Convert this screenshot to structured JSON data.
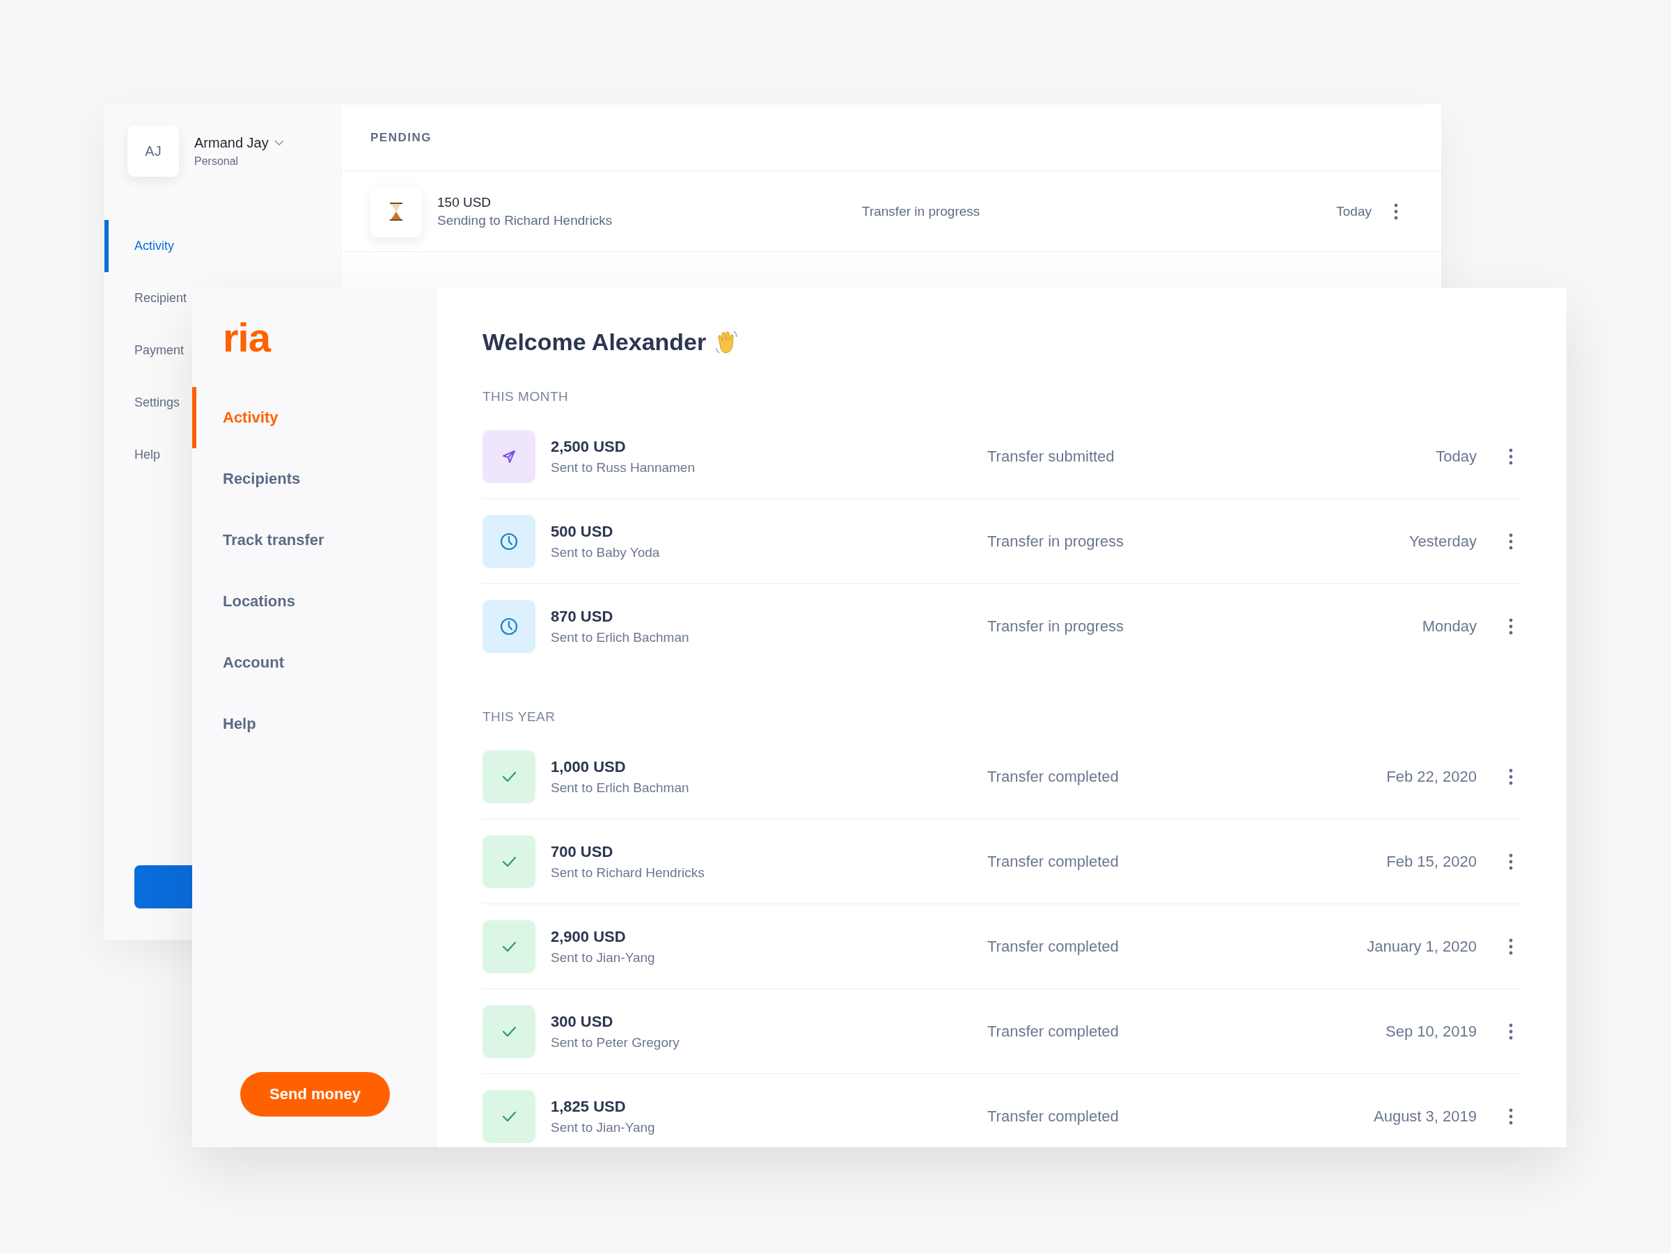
{
  "back_window": {
    "user": {
      "initials": "AJ",
      "name": "Armand Jay",
      "plan": "Personal"
    },
    "nav": [
      {
        "label": "Activity",
        "selected": true
      },
      {
        "label": "Recipient",
        "selected": false
      },
      {
        "label": "Payment",
        "selected": false
      },
      {
        "label": "Settings",
        "selected": false
      },
      {
        "label": "Help",
        "selected": false
      }
    ],
    "section": "PENDING",
    "pending": [
      {
        "amount": "150 USD",
        "description": "Sending to Richard Hendricks",
        "status": "Transfer in progress",
        "date": "Today"
      }
    ]
  },
  "front_window": {
    "logo": "ria",
    "nav": [
      {
        "label": "Activity",
        "selected": true
      },
      {
        "label": "Recipients",
        "selected": false
      },
      {
        "label": "Track transfer",
        "selected": false
      },
      {
        "label": "Locations",
        "selected": false
      },
      {
        "label": "Account",
        "selected": false
      },
      {
        "label": "Help",
        "selected": false
      }
    ],
    "send_button": "Send money",
    "greeting": "Welcome Alexander",
    "groups": [
      {
        "title": "THIS MONTH",
        "transfers": [
          {
            "kind": "submitted",
            "amount": "2,500 USD",
            "recipient": "Sent to Russ Hannamen",
            "status": "Transfer submitted",
            "date": "Today"
          },
          {
            "kind": "in_progress",
            "amount": "500 USD",
            "recipient": "Sent to Baby Yoda",
            "status": "Transfer in progress",
            "date": "Yesterday"
          },
          {
            "kind": "in_progress",
            "amount": "870 USD",
            "recipient": "Sent to Erlich Bachman",
            "status": "Transfer in progress",
            "date": "Monday"
          }
        ]
      },
      {
        "title": "THIS YEAR",
        "transfers": [
          {
            "kind": "completed",
            "amount": "1,000 USD",
            "recipient": "Sent to Erlich Bachman",
            "status": "Transfer completed",
            "date": "Feb 22, 2020"
          },
          {
            "kind": "completed",
            "amount": "700 USD",
            "recipient": "Sent to Richard Hendricks",
            "status": "Transfer completed",
            "date": "Feb 15, 2020"
          },
          {
            "kind": "completed",
            "amount": "2,900 USD",
            "recipient": "Sent to Jian-Yang",
            "status": "Transfer completed",
            "date": "January 1, 2020"
          },
          {
            "kind": "completed",
            "amount": "300 USD",
            "recipient": "Sent to Peter Gregory",
            "status": "Transfer completed",
            "date": "Sep 10, 2019"
          },
          {
            "kind": "completed",
            "amount": "1,825 USD",
            "recipient": "Sent to Jian-Yang",
            "status": "Transfer completed",
            "date": "August 3, 2019"
          }
        ]
      }
    ]
  }
}
